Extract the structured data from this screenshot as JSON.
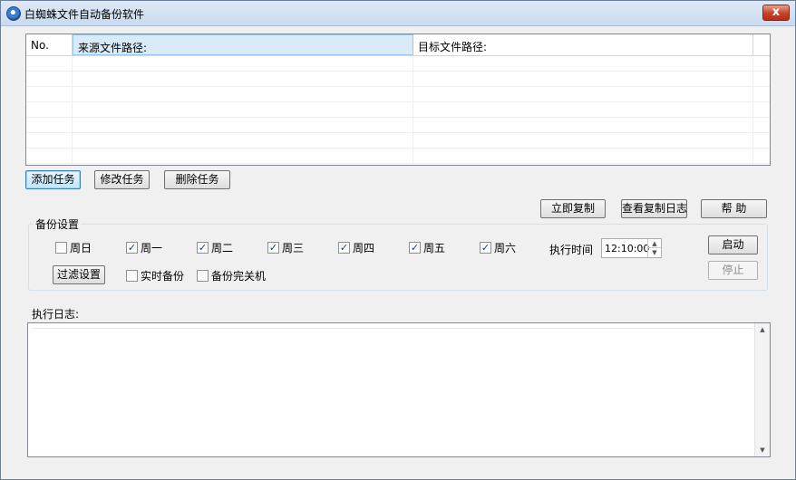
{
  "window": {
    "title": "白蜘蛛文件自动备份软件",
    "close_glyph": "x"
  },
  "table": {
    "headers": {
      "no": "No.",
      "source": "来源文件路径:",
      "target": "目标文件路径:"
    }
  },
  "task_buttons": {
    "add": "添加任务",
    "edit": "修改任务",
    "delete": "删除任务"
  },
  "action_buttons": {
    "copy_now": "立即复制",
    "view_log": "查看复制日志",
    "help": "帮 助"
  },
  "backup_settings": {
    "label": "备份设置",
    "days": [
      {
        "label": "周日",
        "checked": false,
        "mark": ""
      },
      {
        "label": "周一",
        "checked": true,
        "mark": "✓"
      },
      {
        "label": "周二",
        "checked": true,
        "mark": "✓"
      },
      {
        "label": "周三",
        "checked": true,
        "mark": "✓"
      },
      {
        "label": "周四",
        "checked": true,
        "mark": "✓"
      },
      {
        "label": "周五",
        "checked": true,
        "mark": "✓"
      },
      {
        "label": "周六",
        "checked": true,
        "mark": "✓"
      }
    ],
    "exec_time_label": "执行时间",
    "exec_time_value": "12:10:00",
    "filter_button": "过滤设置",
    "realtime": {
      "label": "实时备份",
      "checked": false,
      "mark": ""
    },
    "shutdown": {
      "label": "备份完关机",
      "checked": false,
      "mark": ""
    },
    "start_button": "启动",
    "stop_button": "停止"
  },
  "log": {
    "label": "执行日志:"
  },
  "icons": {
    "spin_up": "▲",
    "spin_down": "▼",
    "scroll_up": "▲",
    "scroll_down": "▼"
  }
}
